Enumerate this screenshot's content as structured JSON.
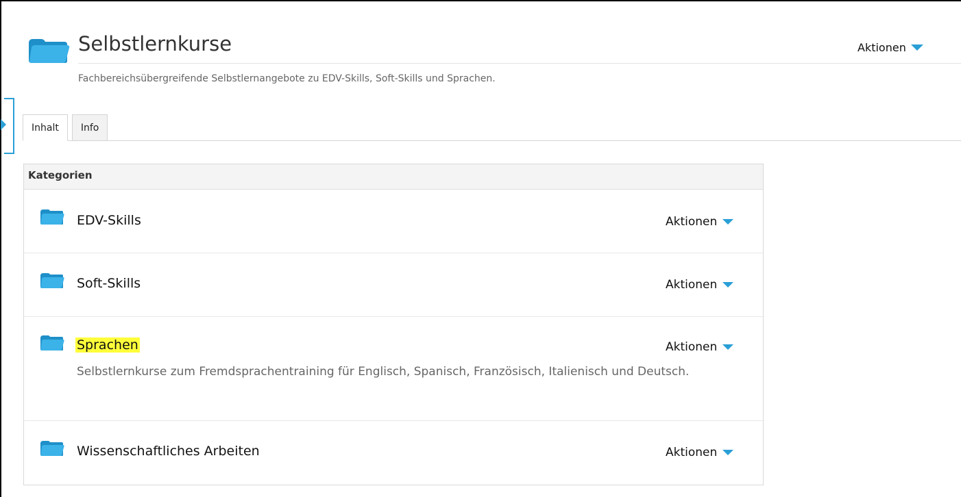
{
  "header": {
    "title": "Selbstlernkurse",
    "description": "Fachbereichsübergreifende Selbstlernangebote zu EDV-Skills, Soft-Skills und Sprachen.",
    "actions_label": "Aktionen",
    "icon": "folder-icon"
  },
  "tabs": [
    {
      "label": "Inhalt",
      "active": true
    },
    {
      "label": "Info",
      "active": false
    }
  ],
  "panel": {
    "heading": "Kategorien",
    "items": [
      {
        "name": "EDV-Skills",
        "description": "",
        "actions_label": "Aktionen",
        "highlighted": false
      },
      {
        "name": "Soft-Skills",
        "description": "",
        "actions_label": "Aktionen",
        "highlighted": false
      },
      {
        "name": "Sprachen",
        "description": "Selbstlernkurse zum Fremdsprachentraining für Englisch, Spanisch, Französisch, Italienisch und Deutsch.",
        "actions_label": "Aktionen",
        "highlighted": true
      },
      {
        "name": "Wissenschaftliches Arbeiten",
        "description": "",
        "actions_label": "Aktionen",
        "highlighted": false
      }
    ]
  },
  "colors": {
    "accent": "#2a9fd6",
    "highlight": "#ffff3a",
    "folder": "#29a8df"
  }
}
